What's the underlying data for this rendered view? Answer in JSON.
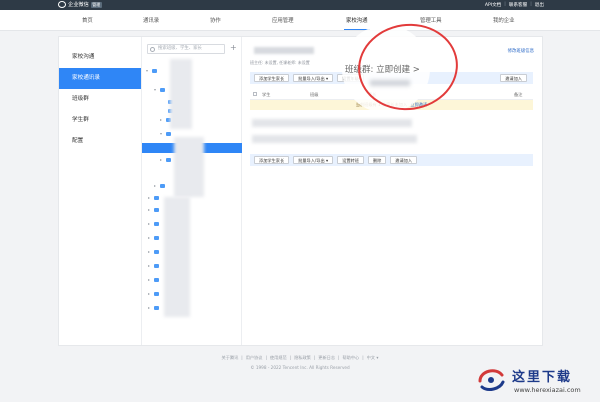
{
  "topbar": {
    "app_name": "企业微信",
    "badge": "管理",
    "links": [
      "API文档",
      "联系客服",
      "退出"
    ]
  },
  "nav": {
    "items": [
      "首页",
      "通讯录",
      "协作",
      "应用管理",
      "家校沟通",
      "管理工具",
      "我的企业"
    ],
    "active": "家校沟通"
  },
  "side_menu": {
    "items": [
      "家校沟通",
      "家校通讯录",
      "班级群",
      "学生群",
      "配置"
    ],
    "active": "家校通讯录"
  },
  "tree": {
    "search_placeholder": "搜索班级、学生、家长",
    "add_symbol": "+"
  },
  "content": {
    "edit_link": "修改班级信息",
    "subinfo": "班主任: 未设置, 任课老师: 未设置",
    "toolbar1": [
      "添加学生家长",
      "批量导入/导出 ▾",
      "设置年级",
      "邀请加入"
    ],
    "table_head": [
      "学生",
      "班级",
      "家长",
      "备注"
    ],
    "notice_text": "当前班级有 1 位家长未加入",
    "notice_link": "立即邀请",
    "toolbar2": [
      "添加学生家长",
      "批量导入/导出 ▾",
      "设置转班",
      "删除",
      "邀请加入"
    ],
    "magnified_text": "班级群: 立即创建 >"
  },
  "footer": {
    "links": [
      "关于腾讯",
      "用户协议",
      "使用规范",
      "隐私政策",
      "更新日志",
      "帮助中心",
      "中文 ▾"
    ],
    "copyright": "© 1998 - 2022 Tencent Inc. All Rights Reserved"
  },
  "watermark": {
    "title": "这里下载",
    "url": "www.herexiazai.com"
  },
  "colors": {
    "accent": "#2f86f6",
    "topbar": "#2e3a46",
    "annotation": "#e23b3b"
  }
}
